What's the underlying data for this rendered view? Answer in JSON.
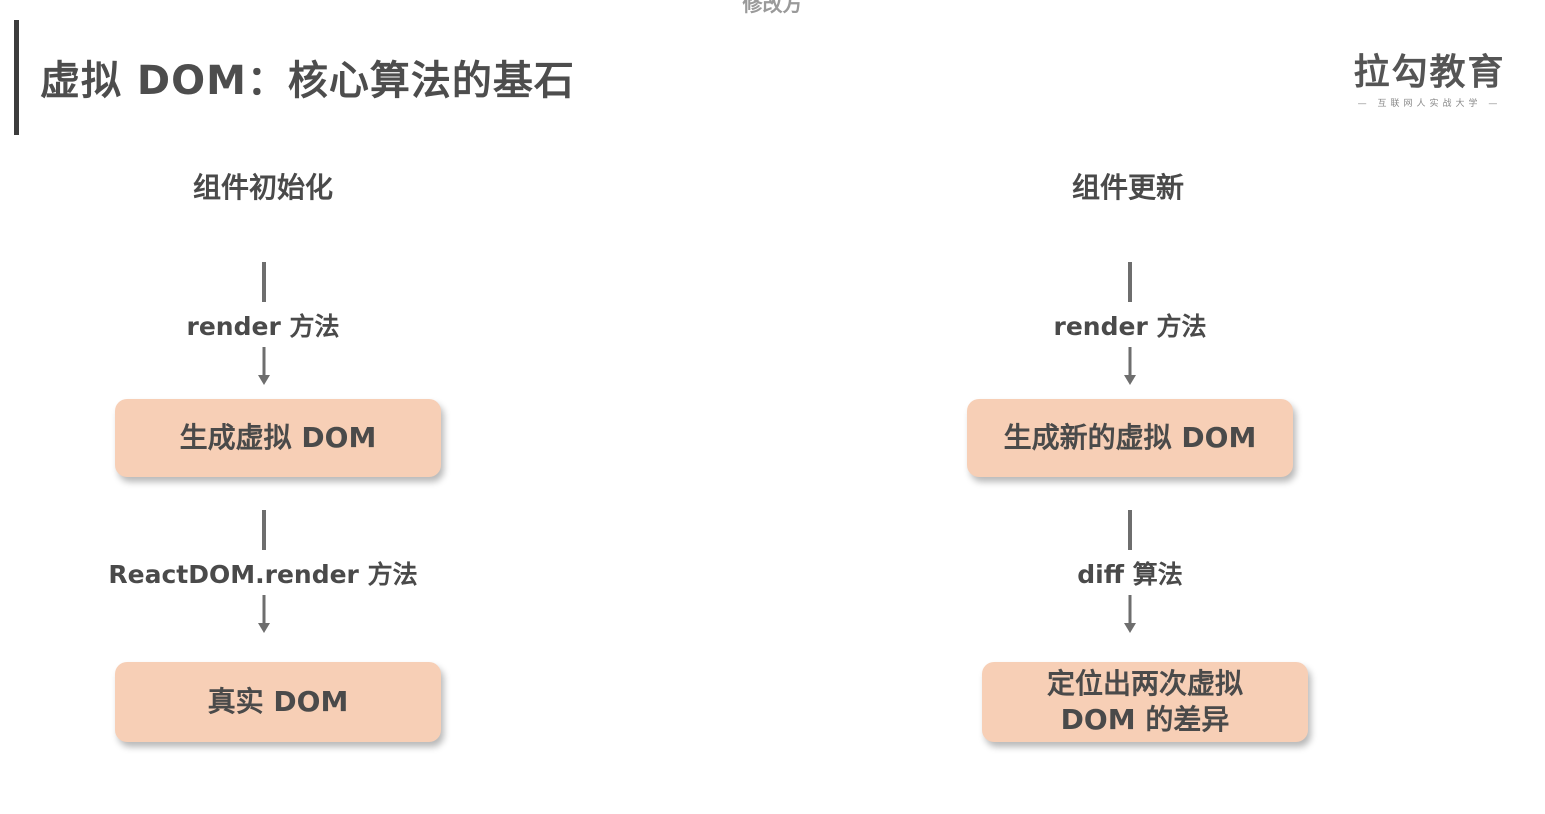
{
  "top_caption": "修改方",
  "title": "虚拟 DOM：核心算法的基石",
  "logo": {
    "main": "拉勾教育",
    "sub": "— 互联网人实战大学 —"
  },
  "left_flow": {
    "heading": "组件初始化",
    "edge1": "render 方法",
    "node1": "生成虚拟 DOM",
    "edge2": "ReactDOM.render 方法",
    "node2": "真实 DOM"
  },
  "right_flow": {
    "heading": "组件更新",
    "edge1": "render 方法",
    "node1": "生成新的虚拟 DOM",
    "edge2": "diff 算法",
    "node2_line1": "定位出两次虚拟",
    "node2_line2": "DOM 的差异"
  },
  "colors": {
    "node_fill": "#f7cfb6",
    "arrow": "#6e6e6e",
    "text": "#4a4a4a"
  }
}
